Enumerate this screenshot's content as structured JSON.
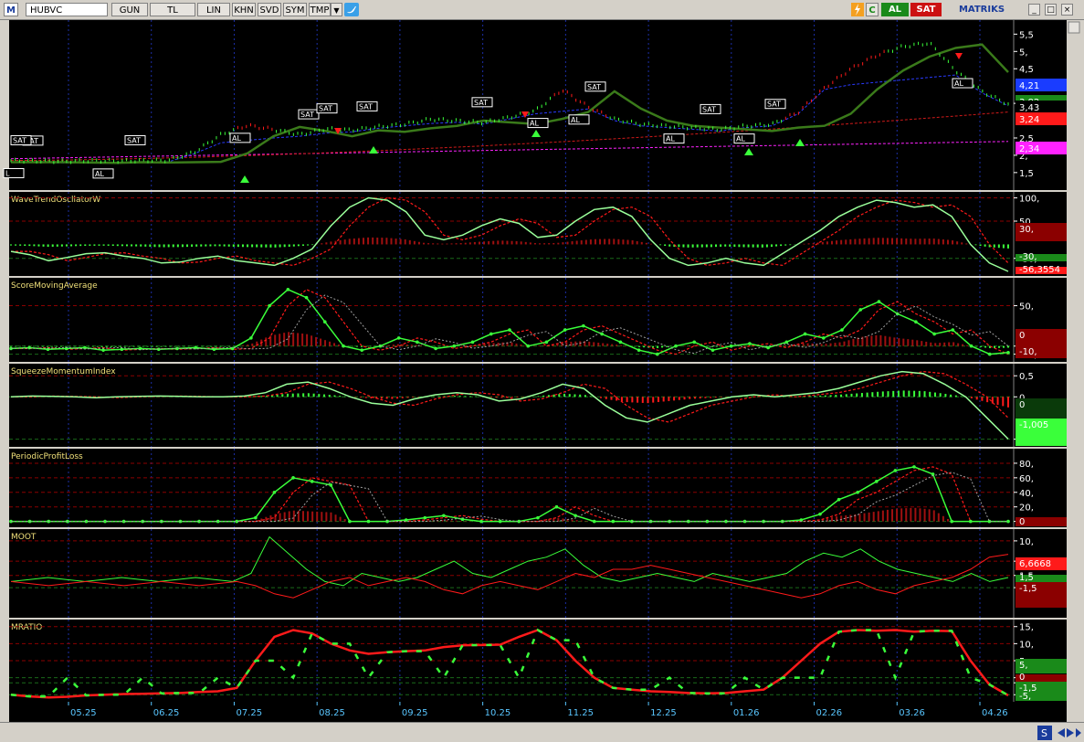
{
  "toolbar": {
    "logo": "M",
    "symbol": "HUBVC",
    "buttons": [
      "GUN",
      "TL",
      "LIN",
      "KHN",
      "SVD",
      "SYM",
      "TMP"
    ],
    "dropdown": "▼",
    "al": "AL",
    "sat": "SAT",
    "brand": "MATRIKS",
    "window": [
      "_",
      "□",
      "×"
    ],
    "icons": [
      "lightning-icon",
      "refresh-icon",
      "twitter-icon"
    ]
  },
  "chart_data": [
    {
      "type": "line",
      "title": "HUBVC",
      "yticks": [
        "5,5",
        "5,",
        "4,5",
        "3,5",
        "2,5",
        "2,",
        "1,5"
      ],
      "ytick_values": [
        5.5,
        5.0,
        4.5,
        3.5,
        2.5,
        2.0,
        1.5
      ],
      "ylim": [
        1.1,
        5.8
      ],
      "price_close": [
        1.8,
        1.79,
        1.78,
        1.8,
        1.79,
        1.8,
        1.81,
        2.05,
        2.55,
        2.82,
        2.7,
        2.55,
        2.72,
        2.68,
        2.78,
        2.85,
        3.0,
        2.95,
        2.9,
        3.05,
        3.25,
        3.85,
        3.35,
        3.0,
        2.85,
        2.8,
        2.75,
        2.7,
        2.8,
        2.85,
        3.2,
        3.9,
        4.45,
        4.85,
        5.1,
        5.2,
        4.4,
        3.8,
        3.43
      ],
      "right_tags": [
        {
          "text": "4,21",
          "color": "#1a3cff"
        },
        {
          "text": "3,82",
          "color": "#1a8a1a"
        },
        {
          "text": "3,43",
          "color": "#000000"
        },
        {
          "text": "3,24",
          "color": "#ff1a1a"
        },
        {
          "text": "2,34",
          "color": "#ff22ff"
        }
      ],
      "signals": [
        "SAT",
        "SAT",
        "AL",
        "SAT",
        "SAT",
        "AL",
        "SAT",
        "SAT",
        "AL",
        "AL",
        "SAT",
        "AL",
        "SAT",
        "AL",
        "SAT",
        "AL",
        "SAT",
        "L"
      ]
    },
    {
      "type": "line",
      "title": "WaveTrendOscllatorW",
      "yticks": [
        "100,",
        "50,",
        "-30,"
      ],
      "ytick_values": [
        100,
        50,
        -30
      ],
      "ylim": [
        -60,
        105
      ],
      "series": [
        {
          "values": [
            -15,
            -22,
            -35,
            -28,
            -20,
            -18,
            -25,
            -30,
            -40,
            -38,
            -30,
            -25,
            -35,
            -40,
            -45,
            -30,
            -10,
            40,
            80,
            100,
            95,
            70,
            20,
            10,
            20,
            40,
            55,
            45,
            15,
            20,
            50,
            75,
            80,
            60,
            10,
            -30,
            -45,
            -40,
            -30,
            -40,
            -45,
            -20,
            5,
            30,
            60,
            80,
            95,
            90,
            80,
            85,
            60,
            0,
            -40,
            -58
          ]
        }
      ],
      "right_tags": [
        {
          "text": "30,",
          "color": "#8b0000"
        },
        {
          "text": "-30,",
          "color": "#1a8a1a"
        },
        {
          "text": "-56,3554",
          "color": "#ff1a1a"
        }
      ]
    },
    {
      "type": "line",
      "title": "ScoreMovingAverage",
      "yticks": [
        "50,",
        "0",
        "-10,"
      ],
      "ytick_values": [
        50,
        0,
        -10
      ],
      "ylim": [
        -15,
        80
      ],
      "series": [
        {
          "values": [
            -3,
            -2,
            -4,
            -3,
            -2,
            -5,
            -4,
            -3,
            -4,
            -3,
            -2,
            -4,
            -3,
            10,
            50,
            70,
            60,
            30,
            0,
            -5,
            0,
            10,
            5,
            -3,
            0,
            5,
            15,
            20,
            0,
            5,
            20,
            25,
            15,
            5,
            -5,
            -10,
            0,
            5,
            -5,
            0,
            3,
            -2,
            5,
            15,
            10,
            20,
            45,
            55,
            40,
            30,
            15,
            20,
            0,
            -10,
            -8
          ]
        }
      ],
      "right_tags": [
        {
          "text": "0",
          "color": "#8b0000"
        },
        {
          "text": "-10,",
          "color": "#8b0000"
        }
      ]
    },
    {
      "type": "line",
      "title": "SqueezeMomentumIndex",
      "yticks": [
        "0,5",
        "0",
        "-1,005"
      ],
      "ytick_values": [
        0.5,
        0,
        -1.005
      ],
      "ylim": [
        -1.1,
        0.7
      ],
      "series": [
        {
          "values": [
            0,
            0.02,
            0.01,
            0,
            -0.02,
            0,
            0.01,
            0.02,
            0.01,
            0,
            0,
            0.02,
            0.1,
            0.3,
            0.35,
            0.2,
            0,
            -0.15,
            -0.2,
            -0.05,
            0.05,
            0.1,
            0.05,
            -0.1,
            -0.05,
            0.1,
            0.3,
            0.2,
            -0.2,
            -0.5,
            -0.6,
            -0.4,
            -0.2,
            -0.1,
            0,
            0.05,
            0,
            0.05,
            0.1,
            0.2,
            0.35,
            0.5,
            0.6,
            0.55,
            0.3,
            0,
            -0.5,
            -1.0
          ]
        }
      ],
      "right_tags": [
        {
          "text": "0",
          "color": "#0a3a0a"
        },
        {
          "text": "-1,005",
          "color": "#3aff3a"
        }
      ]
    },
    {
      "type": "line",
      "title": "PeriodicProfitLoss",
      "yticks": [
        "80,",
        "60,",
        "40,",
        "20,",
        "0"
      ],
      "ytick_values": [
        80,
        60,
        40,
        20,
        0
      ],
      "ylim": [
        -3,
        95
      ],
      "series": [
        {
          "values": [
            0,
            0,
            0,
            0,
            0,
            0,
            0,
            0,
            0,
            0,
            0,
            0,
            0,
            5,
            40,
            60,
            55,
            50,
            0,
            0,
            0,
            2,
            5,
            8,
            3,
            0,
            0,
            0,
            5,
            20,
            8,
            0,
            0,
            0,
            0,
            0,
            0,
            0,
            0,
            0,
            0,
            0,
            2,
            10,
            30,
            40,
            55,
            70,
            75,
            65,
            0,
            0,
            0,
            0
          ]
        }
      ],
      "right_tags": [
        {
          "text": "0",
          "color": "#8b0000"
        }
      ]
    },
    {
      "type": "line",
      "title": "MOOT",
      "yticks": [
        "10,",
        "5,",
        "1,5",
        "-1,5"
      ],
      "ytick_values": [
        10,
        5,
        1.5,
        -1.5
      ],
      "ylim": [
        -8,
        12
      ],
      "series": [
        {
          "values": [
            0,
            0.5,
            1,
            0.5,
            0,
            0.5,
            1,
            0.5,
            0,
            0.5,
            1,
            0.5,
            0,
            2,
            11,
            7,
            3,
            0,
            -1,
            2,
            1,
            0,
            1,
            3,
            5,
            2,
            1,
            3,
            5,
            6,
            8,
            4,
            1,
            0,
            1,
            2,
            1,
            0,
            2,
            1,
            0,
            1,
            2,
            5,
            7,
            6,
            8,
            5,
            3,
            2,
            1,
            0,
            2,
            0,
            1
          ]
        },
        {
          "values": [
            0,
            -0.5,
            -1,
            -0.5,
            0,
            -0.5,
            -1,
            -0.5,
            0,
            -0.5,
            -1,
            -0.5,
            0,
            -1,
            -3,
            -4,
            -2,
            0,
            1,
            -1,
            0,
            1,
            0,
            -2,
            -3,
            -1,
            0,
            -1,
            -2,
            0,
            2,
            1,
            3,
            3,
            4,
            3,
            2,
            1,
            0,
            -1,
            -2,
            -3,
            -4,
            -3,
            -1,
            0,
            -2,
            -3,
            -1,
            0,
            1,
            3,
            6,
            6.7
          ]
        }
      ],
      "right_tags": [
        {
          "text": "6,6668",
          "color": "#ff1a1a"
        },
        {
          "text": "1,5",
          "color": "#1a8a1a"
        },
        {
          "text": "-1,5",
          "color": "#8b0000"
        }
      ]
    },
    {
      "type": "line",
      "title": "MRATIO",
      "yticks": [
        "15,",
        "10,",
        "5,",
        "0",
        "-1,5",
        "-5,"
      ],
      "ytick_values": [
        15,
        10,
        5,
        0,
        -1.5,
        -5
      ],
      "ylim": [
        -6,
        16
      ],
      "series": [
        {
          "values": [
            -5,
            -5.5,
            -5.8,
            -5.6,
            -5.2,
            -5,
            -4.8,
            -4.7,
            -4.6,
            -4.5,
            -4.2,
            -4,
            -3,
            5,
            12,
            14,
            13,
            10,
            8,
            7,
            7.5,
            7.8,
            8,
            9,
            9.5,
            9.6,
            9.7,
            12,
            14,
            11,
            5,
            0,
            -3,
            -3.5,
            -4,
            -4.2,
            -4.5,
            -4.6,
            -4.5,
            -4,
            -3.5,
            0,
            5,
            10,
            13.5,
            14,
            13.8,
            14,
            13.5,
            13.8,
            13.7,
            5,
            -2,
            -5.2
          ]
        }
      ],
      "right_tags": [
        {
          "text": "5,",
          "color": "#1a8a1a"
        },
        {
          "text": "0",
          "color": "#8b0000"
        },
        {
          "text": "-1,5",
          "color": "#1a8a1a"
        },
        {
          "text": "-5,",
          "color": "#1a8a1a"
        }
      ]
    }
  ],
  "xaxis": [
    "05.25",
    "06.25",
    "07.25",
    "08.25",
    "09.25",
    "10.25",
    "11.25",
    "12.25",
    "01.26",
    "02.26",
    "03.26",
    "04.26"
  ]
}
